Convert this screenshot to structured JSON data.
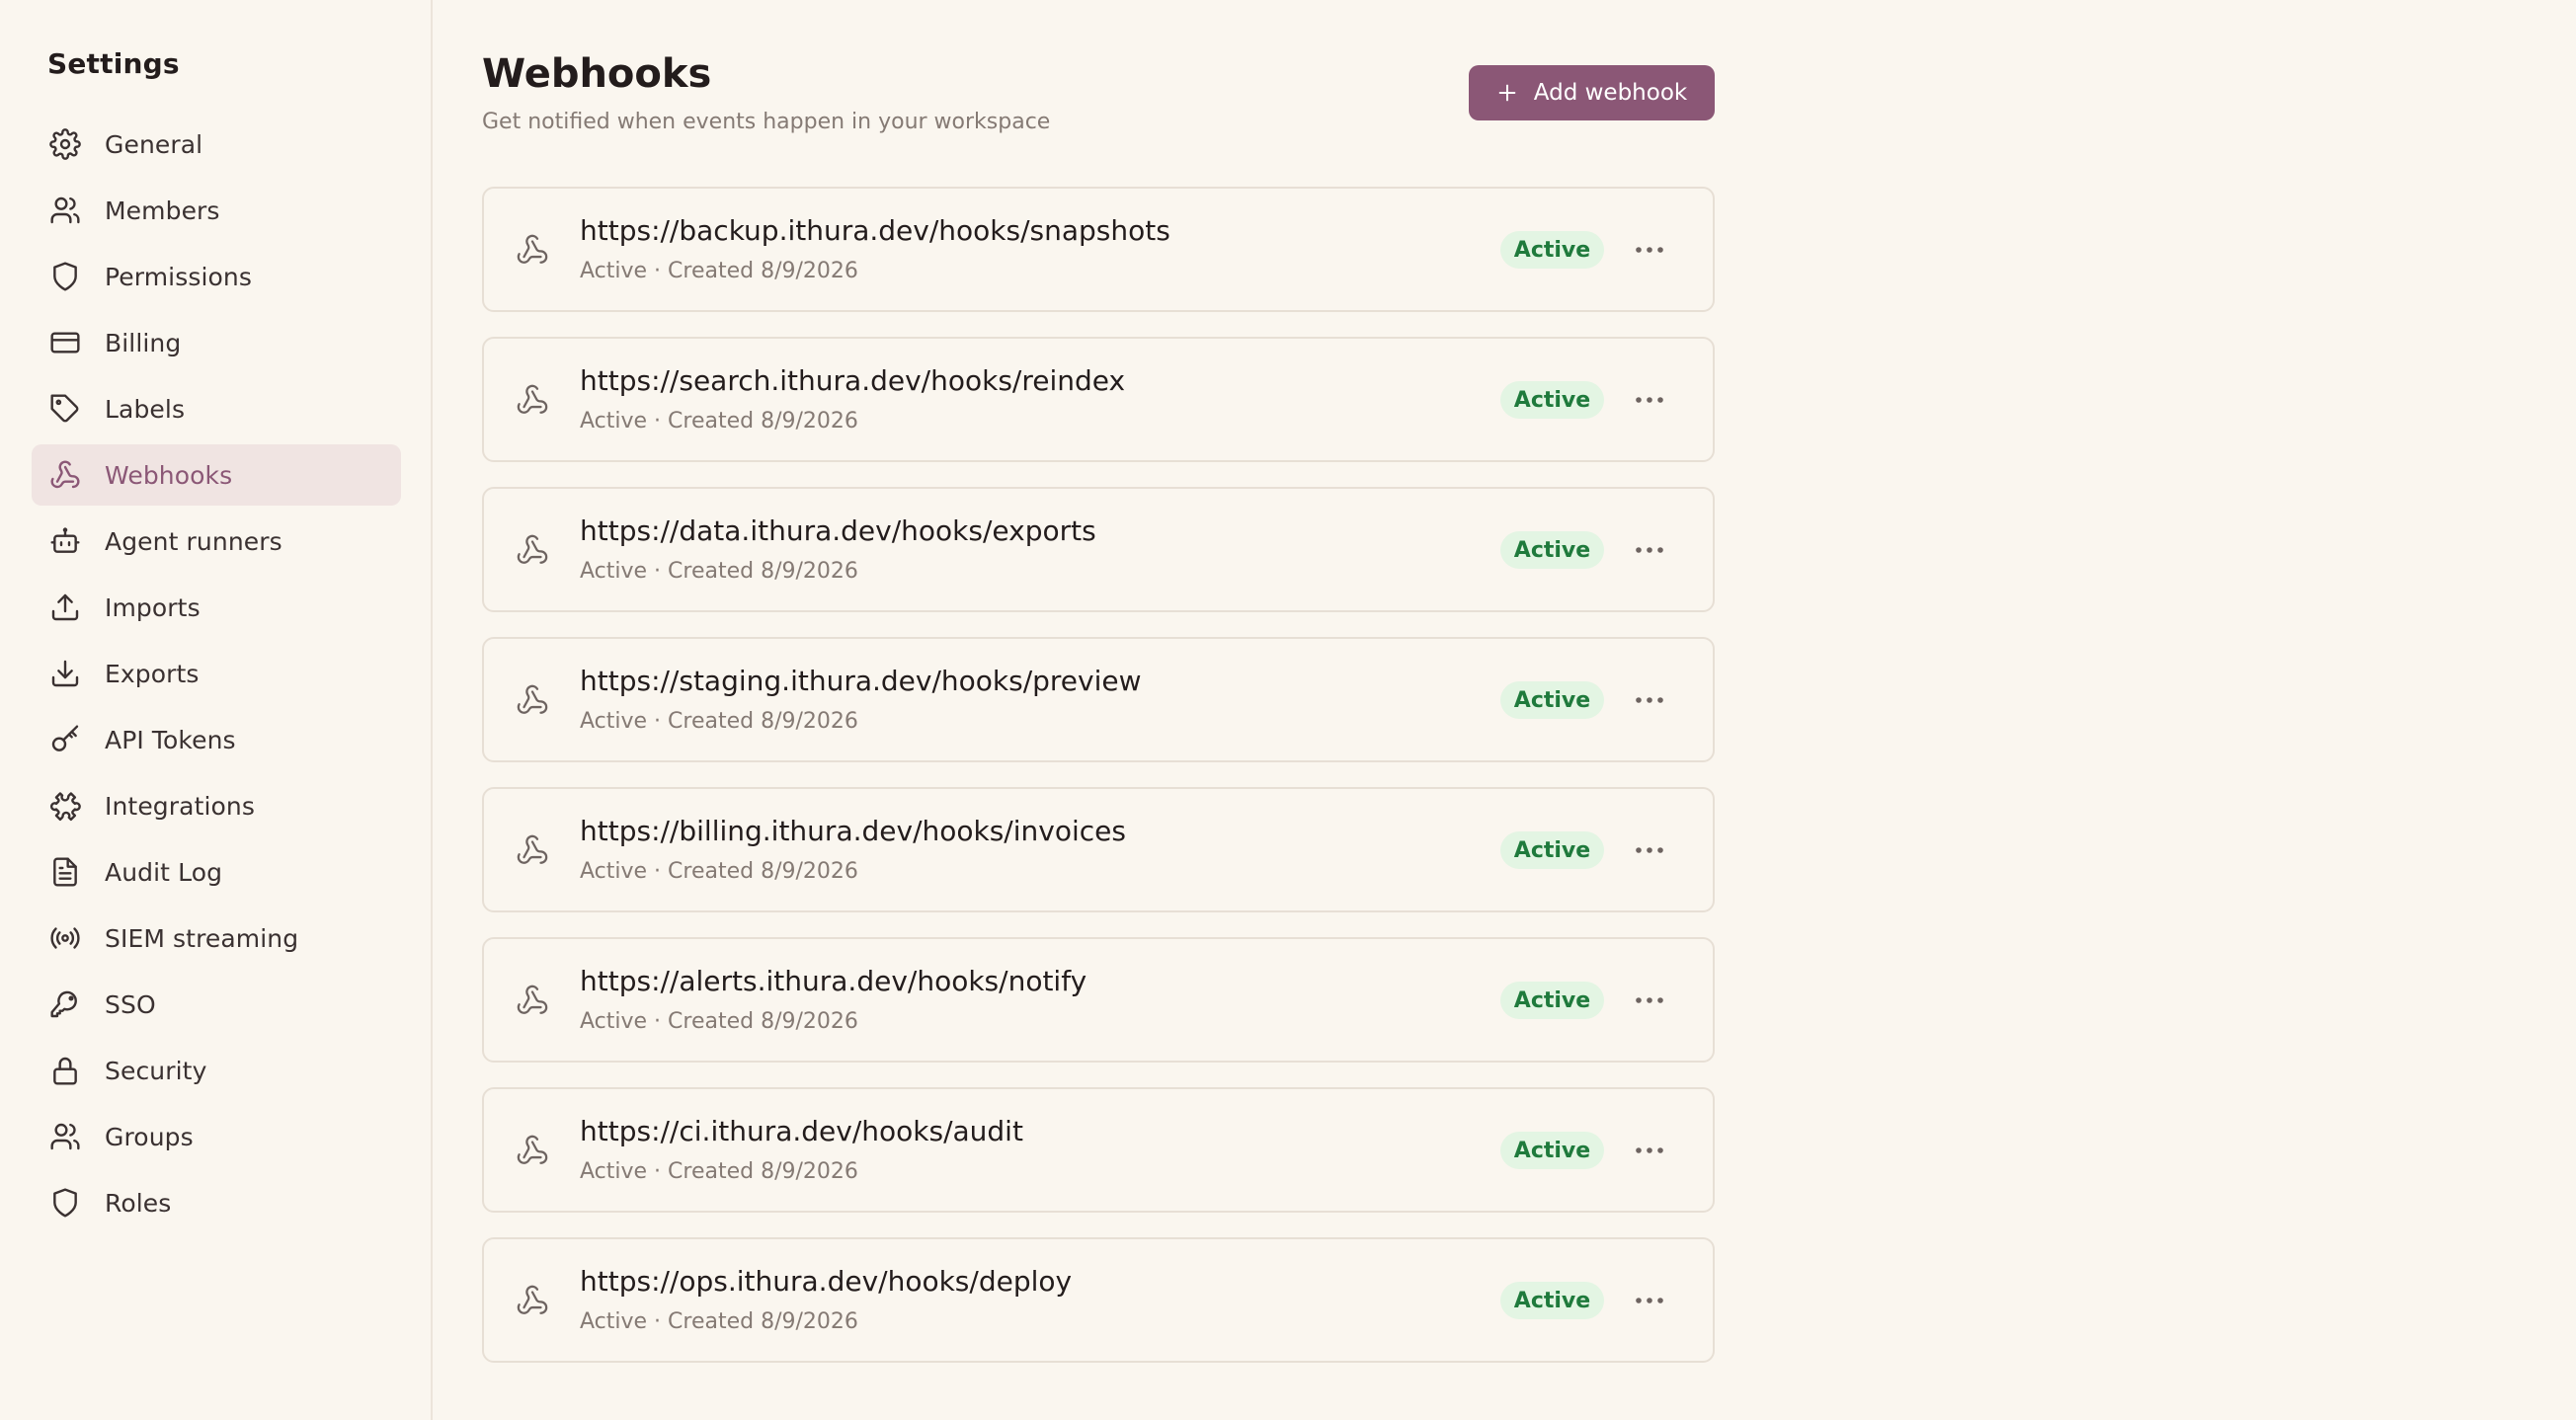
{
  "sidebar": {
    "title": "Settings",
    "items": [
      {
        "label": "General",
        "icon": "gear-icon"
      },
      {
        "label": "Members",
        "icon": "users-icon"
      },
      {
        "label": "Permissions",
        "icon": "shield-icon"
      },
      {
        "label": "Billing",
        "icon": "credit-card-icon"
      },
      {
        "label": "Labels",
        "icon": "tag-icon"
      },
      {
        "label": "Webhooks",
        "icon": "webhook-icon",
        "active": true
      },
      {
        "label": "Agent runners",
        "icon": "bot-icon"
      },
      {
        "label": "Imports",
        "icon": "upload-icon"
      },
      {
        "label": "Exports",
        "icon": "download-icon"
      },
      {
        "label": "API Tokens",
        "icon": "key-icon"
      },
      {
        "label": "Integrations",
        "icon": "puzzle-icon"
      },
      {
        "label": "Audit Log",
        "icon": "file-text-icon"
      },
      {
        "label": "SIEM streaming",
        "icon": "radio-icon"
      },
      {
        "label": "SSO",
        "icon": "key-round-icon"
      },
      {
        "label": "Security",
        "icon": "lock-icon"
      },
      {
        "label": "Groups",
        "icon": "users-group-icon"
      },
      {
        "label": "Roles",
        "icon": "shield-role-icon"
      }
    ]
  },
  "header": {
    "title": "Webhooks",
    "subtitle": "Get notified when events happen in your workspace",
    "add_button_label": "Add webhook"
  },
  "webhooks": [
    {
      "url": "https://backup.ithura.dev/hooks/snapshots",
      "meta": "Active · Created 8/9/2026",
      "status": "Active"
    },
    {
      "url": "https://search.ithura.dev/hooks/reindex",
      "meta": "Active · Created 8/9/2026",
      "status": "Active"
    },
    {
      "url": "https://data.ithura.dev/hooks/exports",
      "meta": "Active · Created 8/9/2026",
      "status": "Active"
    },
    {
      "url": "https://staging.ithura.dev/hooks/preview",
      "meta": "Active · Created 8/9/2026",
      "status": "Active"
    },
    {
      "url": "https://billing.ithura.dev/hooks/invoices",
      "meta": "Active · Created 8/9/2026",
      "status": "Active"
    },
    {
      "url": "https://alerts.ithura.dev/hooks/notify",
      "meta": "Active · Created 8/9/2026",
      "status": "Active"
    },
    {
      "url": "https://ci.ithura.dev/hooks/audit",
      "meta": "Active · Created 8/9/2026",
      "status": "Active"
    },
    {
      "url": "https://ops.ithura.dev/hooks/deploy",
      "meta": "Active · Created 8/9/2026",
      "status": "Active"
    }
  ],
  "colors": {
    "accent": "#8b5776",
    "background": "#faf6ef",
    "active_nav_bg": "#f0e4e2",
    "badge_bg": "#e3f5e3",
    "badge_text": "#1f7a3c"
  }
}
